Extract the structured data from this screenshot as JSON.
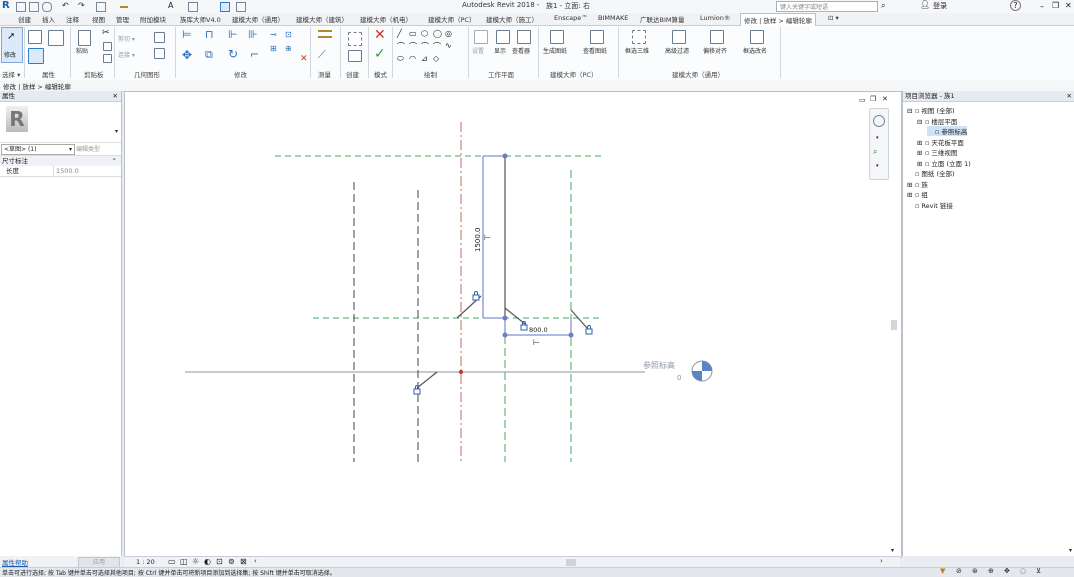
{
  "title_bar": {
    "app_title": "Autodesk Revit 2018 -",
    "doc_title": "族1 - 立面: 右",
    "search_placeholder": "键入关键字或短语",
    "login_label": "登录",
    "help_label": "?"
  },
  "tabs": [
    "创建",
    "插入",
    "注释",
    "视图",
    "管理",
    "附加模块",
    "族库大师V4.0",
    "建模大师（通用）",
    "建模大师（建筑）",
    "建模大师（机电）",
    "建模大师（PC）",
    "建模大师（施工）",
    "Enscape™",
    "BIMMAKE",
    "广联达BIM算量",
    "Lumion®",
    "修改 | 放样 > 编辑轮廓"
  ],
  "tab_menu_label": "⊡ ▾",
  "ribbon": {
    "modify_label": "修改",
    "panels": [
      "选择 ▾",
      "属性",
      "剪贴板",
      "几何图形",
      "修改",
      "测量",
      "创建",
      "模式",
      "绘制",
      "工作平面",
      "建模大师（PC）",
      "建模大师（通用）"
    ],
    "workplane_buttons": [
      "设置",
      "显示",
      "查看器"
    ],
    "pc_buttons": [
      "生成图纸",
      "查看图纸"
    ],
    "general_buttons": [
      "框选三维",
      "高级过滤",
      "偏移对齐",
      "框选改名"
    ],
    "clipboard_small": [
      "剪切 ▾",
      "连接 ▾"
    ],
    "paste_label": "粘贴"
  },
  "context_bar": "修改 | 放样 > 编辑轮廓",
  "properties": {
    "header": "属性",
    "type_selector": "<草图> (1)",
    "edit_type": "编辑类型",
    "group": "尺寸标注",
    "param_name": "长度",
    "param_value": "1500.0",
    "help_link": "属性帮助",
    "apply_button": "应用"
  },
  "canvas": {
    "dim_vertical": "1500.0",
    "dim_horizontal": "800.0",
    "ref_level_label": "参照标高",
    "ref_level_value": "0"
  },
  "view_bar": {
    "scale": "1 : 20"
  },
  "project_browser": {
    "header": "项目浏览器 - 族1",
    "items": [
      {
        "label": "视图 (全部)",
        "depth": 0,
        "toggle": "⊟"
      },
      {
        "label": "楼层平面",
        "depth": 1,
        "toggle": "⊟"
      },
      {
        "label": "参照标高",
        "depth": 2,
        "toggle": ""
      },
      {
        "label": "天花板平面",
        "depth": 1,
        "toggle": "⊞"
      },
      {
        "label": "三维视图",
        "depth": 1,
        "toggle": "⊞"
      },
      {
        "label": "立面 (立面 1)",
        "depth": 1,
        "toggle": "⊞"
      },
      {
        "label": "图纸 (全部)",
        "depth": 0,
        "toggle": ""
      },
      {
        "label": "族",
        "depth": 0,
        "toggle": "⊞"
      },
      {
        "label": "组",
        "depth": 0,
        "toggle": "⊞"
      },
      {
        "label": "Revit 链接",
        "depth": 0,
        "toggle": ""
      }
    ]
  },
  "status_bar": {
    "text": "单击可进行选择; 按 Tab 键并单击可选择其他项目; 按 Ctrl 键并单击可将新项目添加到选择集; 按 Shift 键并单击可取消选择。"
  },
  "colors": {
    "accent": "#2f7fcf",
    "ribbon_bg": "#fbfcfd",
    "green_dash": "#3fae5f",
    "dim_blue": "#5a74c8"
  }
}
